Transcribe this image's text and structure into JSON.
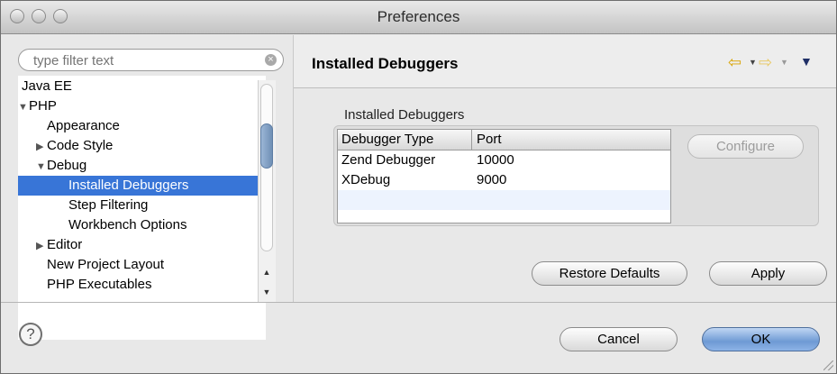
{
  "window": {
    "title": "Preferences"
  },
  "filter": {
    "placeholder": "type filter text",
    "value": ""
  },
  "tree": [
    {
      "label": "Java EE",
      "indent": 0,
      "expander": "",
      "selected": false
    },
    {
      "label": "PHP",
      "indent": 0,
      "expander": "▼",
      "selected": false
    },
    {
      "label": "Appearance",
      "indent": 1,
      "expander": "",
      "selected": false
    },
    {
      "label": "Code Style",
      "indent": 1,
      "expander": "▶",
      "selected": false
    },
    {
      "label": "Debug",
      "indent": 1,
      "expander": "▼",
      "selected": false
    },
    {
      "label": "Installed Debuggers",
      "indent": 2,
      "expander": "",
      "selected": true
    },
    {
      "label": "Step Filtering",
      "indent": 2,
      "expander": "",
      "selected": false
    },
    {
      "label": "Workbench Options",
      "indent": 2,
      "expander": "",
      "selected": false
    },
    {
      "label": "Editor",
      "indent": 1,
      "expander": "▶",
      "selected": false
    },
    {
      "label": "New Project Layout",
      "indent": 1,
      "expander": "",
      "selected": false
    },
    {
      "label": "PHP Executables",
      "indent": 1,
      "expander": "",
      "selected": false
    }
  ],
  "page": {
    "title": "Installed Debuggers",
    "group_label": "Installed Debuggers",
    "columns": [
      "Debugger Type",
      "Port"
    ],
    "rows": [
      [
        "Zend Debugger",
        "10000"
      ],
      [
        "XDebug",
        "9000"
      ]
    ],
    "configure_label": "Configure",
    "restore_label": "Restore Defaults",
    "apply_label": "Apply"
  },
  "footer": {
    "help_glyph": "?",
    "cancel_label": "Cancel",
    "ok_label": "OK"
  },
  "icons": {
    "back": "arrow-left-icon",
    "forward": "arrow-right-icon",
    "menu": "view-menu-icon",
    "help": "help-icon"
  },
  "colors": {
    "selection": "#3875d7",
    "nav_arrow": "#d9a300",
    "default_button": "#6e9ad4"
  }
}
